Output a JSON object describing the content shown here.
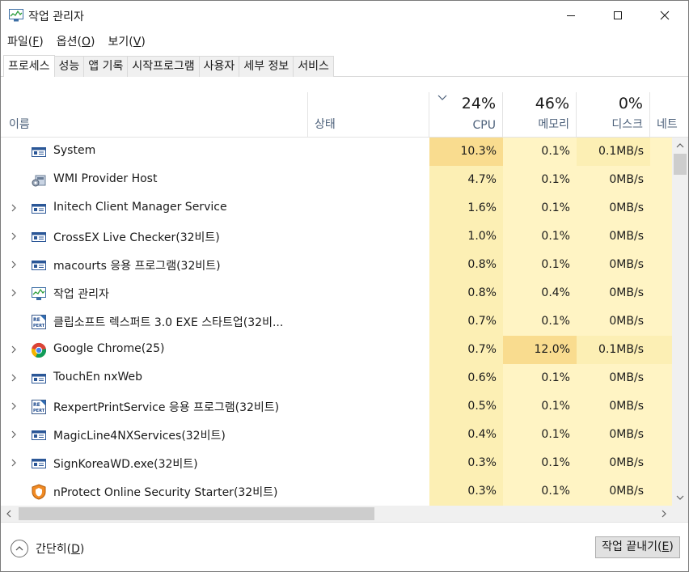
{
  "window": {
    "title": "작업 관리자",
    "icon": "task-manager-icon"
  },
  "menu": [
    {
      "label": "파일",
      "accel": "F"
    },
    {
      "label": "옵션",
      "accel": "O"
    },
    {
      "label": "보기",
      "accel": "V"
    }
  ],
  "tabs": [
    "프로세스",
    "성능",
    "앱 기록",
    "시작프로그램",
    "사용자",
    "세부 정보",
    "서비스"
  ],
  "active_tab": "프로세스",
  "columns": {
    "name": "이름",
    "status": "상태",
    "cpu": {
      "label": "CPU",
      "total": "24%"
    },
    "memory": {
      "label": "메모리",
      "total": "46%"
    },
    "disk": {
      "label": "디스크",
      "total": "0%"
    },
    "network": {
      "label": "네트"
    }
  },
  "processes": [
    {
      "name": "System",
      "icon": "window-icon",
      "expandable": false,
      "cpu": "10.3%",
      "memory": "0.1%",
      "disk": "0.1MB/s"
    },
    {
      "name": "WMI Provider Host",
      "icon": "wmi-icon",
      "expandable": false,
      "cpu": "4.7%",
      "memory": "0.1%",
      "disk": "0MB/s"
    },
    {
      "name": "Initech Client Manager Service",
      "icon": "window-icon",
      "expandable": true,
      "cpu": "1.6%",
      "memory": "0.1%",
      "disk": "0MB/s"
    },
    {
      "name": "CrossEX Live Checker(32비트)",
      "icon": "window-icon",
      "expandable": true,
      "cpu": "1.0%",
      "memory": "0.1%",
      "disk": "0MB/s"
    },
    {
      "name": "macourts 응용 프로그램(32비트)",
      "icon": "window-icon",
      "expandable": true,
      "cpu": "0.8%",
      "memory": "0.1%",
      "disk": "0MB/s"
    },
    {
      "name": "작업 관리자",
      "icon": "task-manager-icon",
      "expandable": true,
      "cpu": "0.8%",
      "memory": "0.4%",
      "disk": "0MB/s"
    },
    {
      "name": "클립소프트 렉스퍼트 3.0 EXE 스타트업(32비...",
      "icon": "rexpert-icon",
      "expandable": false,
      "cpu": "0.7%",
      "memory": "0.1%",
      "disk": "0MB/s"
    },
    {
      "name": "Google Chrome(25)",
      "icon": "chrome-icon",
      "expandable": true,
      "cpu": "0.7%",
      "memory": "12.0%",
      "disk": "0.1MB/s"
    },
    {
      "name": "TouchEn nxWeb",
      "icon": "window-icon",
      "expandable": true,
      "cpu": "0.6%",
      "memory": "0.1%",
      "disk": "0MB/s"
    },
    {
      "name": "RexpertPrintService 응용 프로그램(32비트)",
      "icon": "rexpert-icon",
      "expandable": true,
      "cpu": "0.5%",
      "memory": "0.1%",
      "disk": "0MB/s"
    },
    {
      "name": "MagicLine4NXServices(32비트)",
      "icon": "window-icon",
      "expandable": true,
      "cpu": "0.4%",
      "memory": "0.1%",
      "disk": "0MB/s"
    },
    {
      "name": "SignKoreaWD.exe(32비트)",
      "icon": "window-icon",
      "expandable": true,
      "cpu": "0.3%",
      "memory": "0.1%",
      "disk": "0MB/s"
    },
    {
      "name": "nProtect Online Security Starter(32비트)",
      "icon": "nprotect-icon",
      "expandable": false,
      "cpu": "0.3%",
      "memory": "0.1%",
      "disk": "0MB/s"
    }
  ],
  "footer": {
    "collapse_label": "간단히",
    "collapse_accel": "D",
    "end_task_label": "작업 끝내기",
    "end_task_accel": "E"
  },
  "colors": {
    "heat_light": "#fff4c4",
    "heat_mid": "#fcefb4",
    "heat_strong": "#f9dc8f",
    "header_label": "#4c607a"
  }
}
